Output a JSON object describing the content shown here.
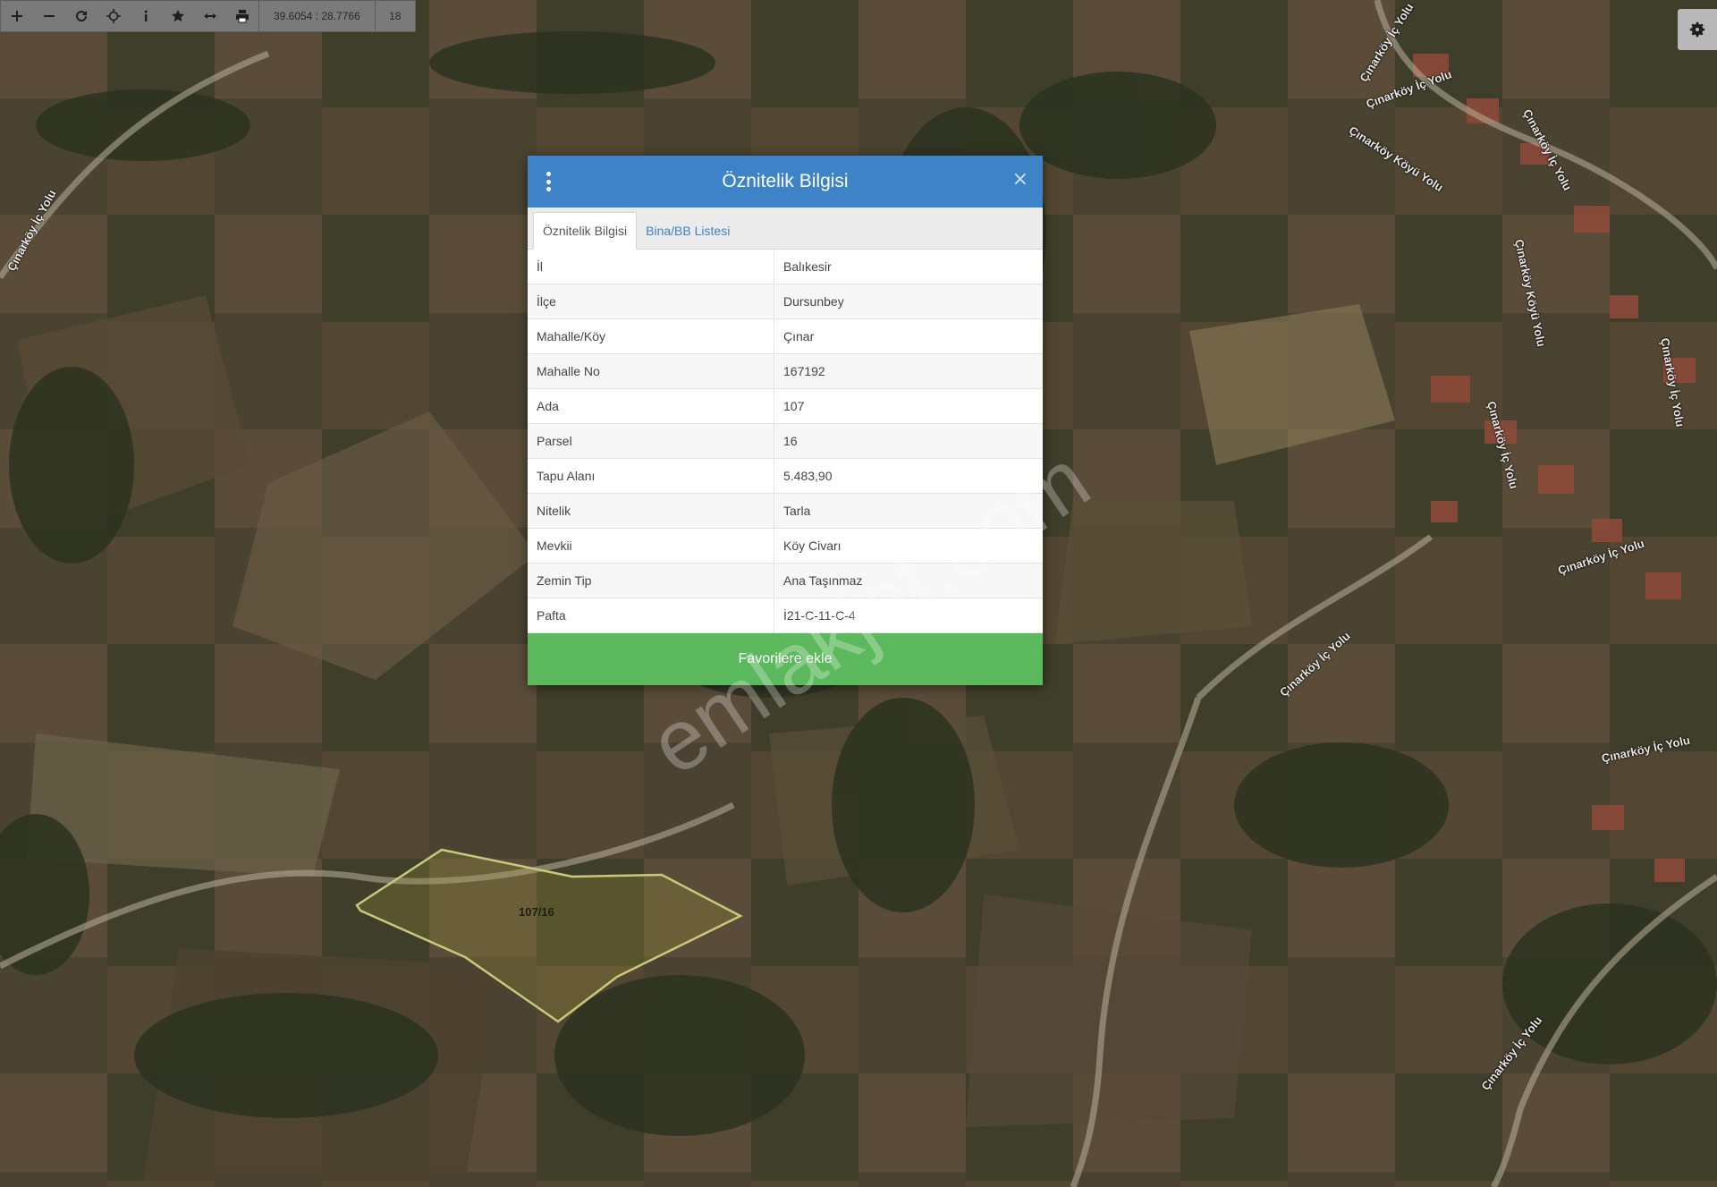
{
  "toolbar": {
    "icons": [
      "zoom-in-icon",
      "zoom-out-icon",
      "refresh-icon",
      "locate-icon",
      "info-icon",
      "star-icon",
      "measure-icon",
      "print-icon"
    ],
    "coordinates": "39.6054 : 28.7766",
    "zoom_level": "18"
  },
  "map": {
    "parcel_label": "107/16",
    "road_labels": [
      "Çınarköy İç Yolu",
      "Çınarköy İç Yolu",
      "Çınarköy Köyü Yolu",
      "Çınarköy İç Yolu",
      "Çınarköy Köyü Yolu",
      "Çınarköy İç Yolu",
      "Çınarköy İç Yolu",
      "Çınarköy İç Yolu",
      "Çınarköy İç Yolu",
      "Çınarköy İç Yolu",
      "Çınarköy İç Yolu",
      "Çınarköy İç Yolu"
    ],
    "watermark": "emlakjet.com",
    "parcel_outline_color": "#c9c97a"
  },
  "dialog": {
    "title": "Öznitelik Bilgisi",
    "close_symbol": "×",
    "tabs": [
      {
        "label": "Öznitelik Bilgisi",
        "active": true
      },
      {
        "label": "Bina/BB Listesi",
        "active": false
      }
    ],
    "rows": [
      {
        "key": "İl",
        "value": "Balıkesir"
      },
      {
        "key": "İlçe",
        "value": "Dursunbey"
      },
      {
        "key": "Mahalle/Köy",
        "value": "Çınar"
      },
      {
        "key": "Mahalle No",
        "value": "167192"
      },
      {
        "key": "Ada",
        "value": "107"
      },
      {
        "key": "Parsel",
        "value": "16"
      },
      {
        "key": "Tapu Alanı",
        "value": "5.483,90"
      },
      {
        "key": "Nitelik",
        "value": "Tarla"
      },
      {
        "key": "Mevkii",
        "value": "Köy Civarı"
      },
      {
        "key": "Zemin Tip",
        "value": "Ana Taşınmaz"
      },
      {
        "key": "Pafta",
        "value": "İ21-C-11-C-4"
      }
    ],
    "favorite_button": "Favorilere ekle",
    "header_color": "#3e82c7",
    "button_color": "#5cb85c"
  }
}
